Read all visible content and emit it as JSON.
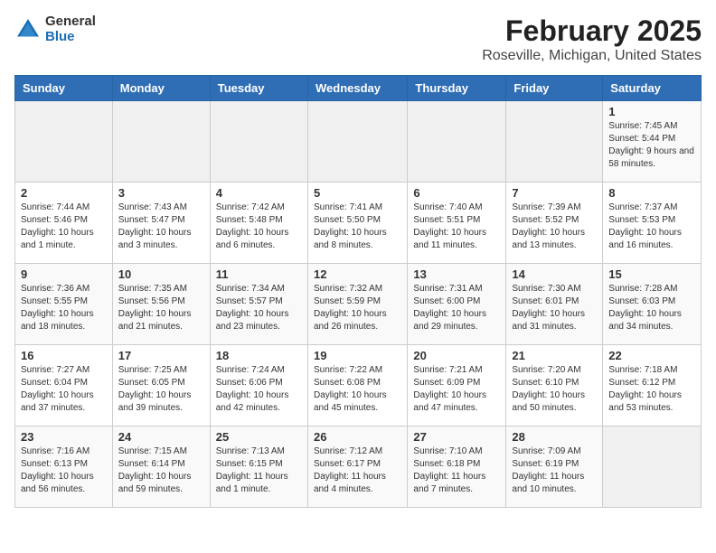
{
  "logo": {
    "general": "General",
    "blue": "Blue"
  },
  "title": "February 2025",
  "subtitle": "Roseville, Michigan, United States",
  "headers": [
    "Sunday",
    "Monday",
    "Tuesday",
    "Wednesday",
    "Thursday",
    "Friday",
    "Saturday"
  ],
  "weeks": [
    [
      {
        "day": "",
        "info": ""
      },
      {
        "day": "",
        "info": ""
      },
      {
        "day": "",
        "info": ""
      },
      {
        "day": "",
        "info": ""
      },
      {
        "day": "",
        "info": ""
      },
      {
        "day": "",
        "info": ""
      },
      {
        "day": "1",
        "info": "Sunrise: 7:45 AM\nSunset: 5:44 PM\nDaylight: 9 hours and 58 minutes."
      }
    ],
    [
      {
        "day": "2",
        "info": "Sunrise: 7:44 AM\nSunset: 5:46 PM\nDaylight: 10 hours and 1 minute."
      },
      {
        "day": "3",
        "info": "Sunrise: 7:43 AM\nSunset: 5:47 PM\nDaylight: 10 hours and 3 minutes."
      },
      {
        "day": "4",
        "info": "Sunrise: 7:42 AM\nSunset: 5:48 PM\nDaylight: 10 hours and 6 minutes."
      },
      {
        "day": "5",
        "info": "Sunrise: 7:41 AM\nSunset: 5:50 PM\nDaylight: 10 hours and 8 minutes."
      },
      {
        "day": "6",
        "info": "Sunrise: 7:40 AM\nSunset: 5:51 PM\nDaylight: 10 hours and 11 minutes."
      },
      {
        "day": "7",
        "info": "Sunrise: 7:39 AM\nSunset: 5:52 PM\nDaylight: 10 hours and 13 minutes."
      },
      {
        "day": "8",
        "info": "Sunrise: 7:37 AM\nSunset: 5:53 PM\nDaylight: 10 hours and 16 minutes."
      }
    ],
    [
      {
        "day": "9",
        "info": "Sunrise: 7:36 AM\nSunset: 5:55 PM\nDaylight: 10 hours and 18 minutes."
      },
      {
        "day": "10",
        "info": "Sunrise: 7:35 AM\nSunset: 5:56 PM\nDaylight: 10 hours and 21 minutes."
      },
      {
        "day": "11",
        "info": "Sunrise: 7:34 AM\nSunset: 5:57 PM\nDaylight: 10 hours and 23 minutes."
      },
      {
        "day": "12",
        "info": "Sunrise: 7:32 AM\nSunset: 5:59 PM\nDaylight: 10 hours and 26 minutes."
      },
      {
        "day": "13",
        "info": "Sunrise: 7:31 AM\nSunset: 6:00 PM\nDaylight: 10 hours and 29 minutes."
      },
      {
        "day": "14",
        "info": "Sunrise: 7:30 AM\nSunset: 6:01 PM\nDaylight: 10 hours and 31 minutes."
      },
      {
        "day": "15",
        "info": "Sunrise: 7:28 AM\nSunset: 6:03 PM\nDaylight: 10 hours and 34 minutes."
      }
    ],
    [
      {
        "day": "16",
        "info": "Sunrise: 7:27 AM\nSunset: 6:04 PM\nDaylight: 10 hours and 37 minutes."
      },
      {
        "day": "17",
        "info": "Sunrise: 7:25 AM\nSunset: 6:05 PM\nDaylight: 10 hours and 39 minutes."
      },
      {
        "day": "18",
        "info": "Sunrise: 7:24 AM\nSunset: 6:06 PM\nDaylight: 10 hours and 42 minutes."
      },
      {
        "day": "19",
        "info": "Sunrise: 7:22 AM\nSunset: 6:08 PM\nDaylight: 10 hours and 45 minutes."
      },
      {
        "day": "20",
        "info": "Sunrise: 7:21 AM\nSunset: 6:09 PM\nDaylight: 10 hours and 47 minutes."
      },
      {
        "day": "21",
        "info": "Sunrise: 7:20 AM\nSunset: 6:10 PM\nDaylight: 10 hours and 50 minutes."
      },
      {
        "day": "22",
        "info": "Sunrise: 7:18 AM\nSunset: 6:12 PM\nDaylight: 10 hours and 53 minutes."
      }
    ],
    [
      {
        "day": "23",
        "info": "Sunrise: 7:16 AM\nSunset: 6:13 PM\nDaylight: 10 hours and 56 minutes."
      },
      {
        "day": "24",
        "info": "Sunrise: 7:15 AM\nSunset: 6:14 PM\nDaylight: 10 hours and 59 minutes."
      },
      {
        "day": "25",
        "info": "Sunrise: 7:13 AM\nSunset: 6:15 PM\nDaylight: 11 hours and 1 minute."
      },
      {
        "day": "26",
        "info": "Sunrise: 7:12 AM\nSunset: 6:17 PM\nDaylight: 11 hours and 4 minutes."
      },
      {
        "day": "27",
        "info": "Sunrise: 7:10 AM\nSunset: 6:18 PM\nDaylight: 11 hours and 7 minutes."
      },
      {
        "day": "28",
        "info": "Sunrise: 7:09 AM\nSunset: 6:19 PM\nDaylight: 11 hours and 10 minutes."
      },
      {
        "day": "",
        "info": ""
      }
    ]
  ]
}
